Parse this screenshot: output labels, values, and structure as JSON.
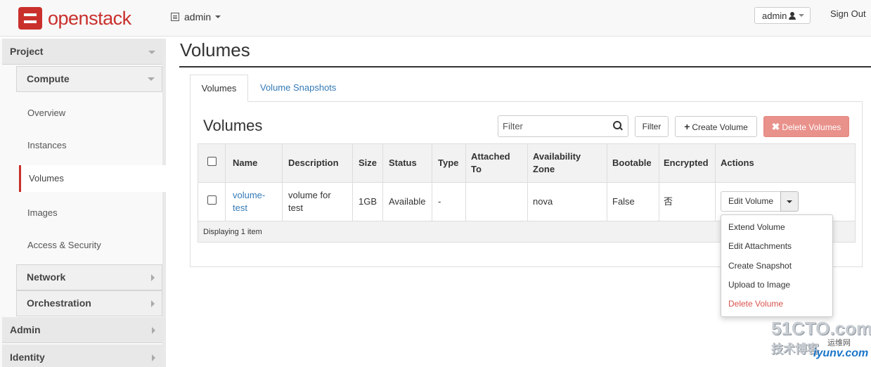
{
  "header": {
    "brand": "openstack",
    "project": "admin",
    "user": "admin",
    "signout": "Sign Out"
  },
  "sidebar": {
    "project": "Project",
    "compute": "Compute",
    "items": [
      "Overview",
      "Instances",
      "Volumes",
      "Images",
      "Access & Security"
    ],
    "network": "Network",
    "orchestration": "Orchestration",
    "admin": "Admin",
    "identity": "Identity"
  },
  "page": {
    "title": "Volumes",
    "tabs": [
      "Volumes",
      "Volume Snapshots"
    ],
    "section_title": "Volumes",
    "filter_placeholder": "Filter",
    "filter_button": "Filter",
    "create_button": "Create Volume",
    "delete_button": "Delete Volumes"
  },
  "table": {
    "columns": [
      "Name",
      "Description",
      "Size",
      "Status",
      "Type",
      "Attached",
      "To",
      "Availability",
      "Zone",
      "Bootable",
      "Encrypted",
      "Actions"
    ],
    "row": {
      "name_line1": "volume-",
      "name_line2": "test",
      "desc_line1": "volume for",
      "desc_line2": "test",
      "size": "1GB",
      "status": "Available",
      "type": "-",
      "attached": "",
      "zone": "nova",
      "bootable": "False",
      "encrypted": "否",
      "action": "Edit Volume"
    },
    "footer": "Displaying 1 item"
  },
  "dropdown": [
    "Extend Volume",
    "Edit Attachments",
    "Create Snapshot",
    "Upload to Image",
    "Delete Volume"
  ],
  "watermark": {
    "line1": "51CTO.com",
    "line2": "技术博客",
    "line3": "运维网",
    "line4": "iyunv.com"
  },
  "colors": {
    "brand": "#c9302c",
    "link": "#337ab7",
    "danger": "#d9534f"
  }
}
